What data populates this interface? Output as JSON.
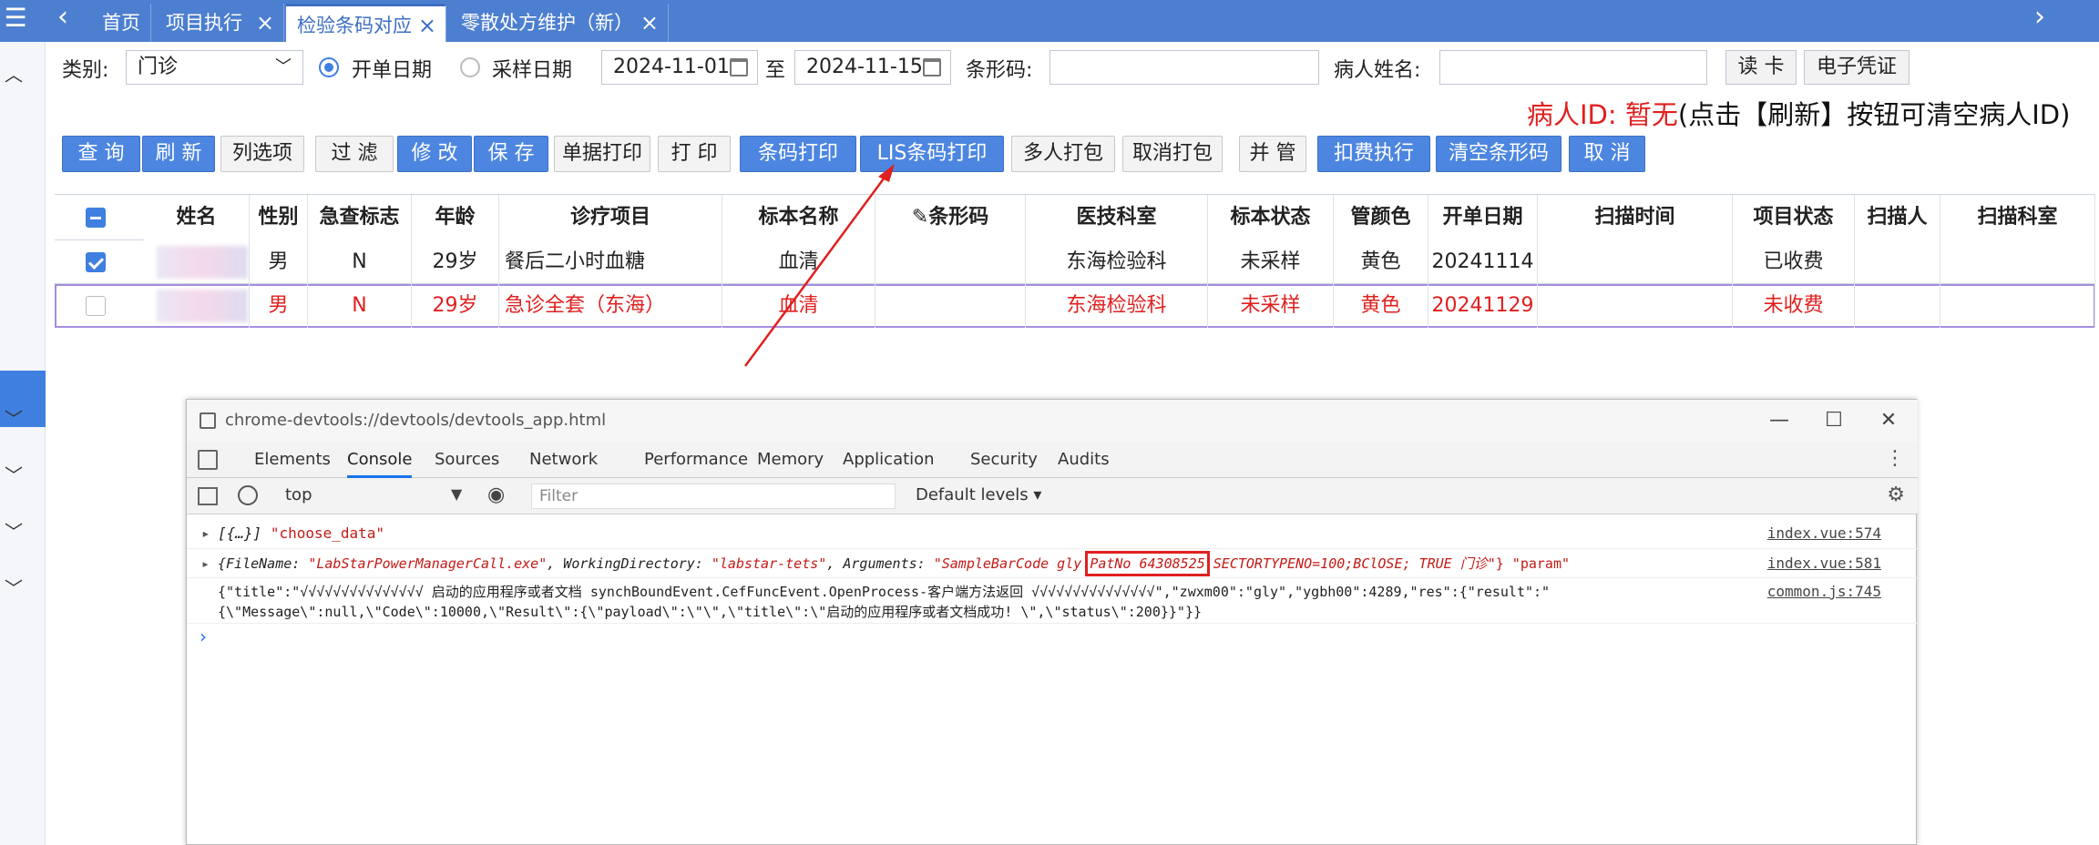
{
  "tabs": [
    {
      "label": "首页",
      "closable": false
    },
    {
      "label": "项目执行",
      "closable": true
    },
    {
      "label": "检验条码对应",
      "closable": true,
      "active": true
    },
    {
      "label": "零散处方维护（新）",
      "closable": true
    }
  ],
  "tab_close_icon": "×",
  "form": {
    "category_label": "类别:",
    "category_value": "门诊",
    "radio_order_date": "开单日期",
    "radio_sample_date": "采样日期",
    "date_from": "2024-11-01",
    "date_sep": "至",
    "date_to": "2024-11-15",
    "barcode_label": "条形码:",
    "patient_name_label": "病人姓名:",
    "read_card": "读 卡",
    "e_voucher": "电子凭证",
    "hint_prefix": "病人ID: 暂无",
    "hint_suffix": "(点击【刷新】按钮可清空病人ID)"
  },
  "toolbar": [
    {
      "label": "查 询",
      "style": "blue"
    },
    {
      "label": "刷 新",
      "style": "blue"
    },
    {
      "label": "列选项",
      "style": "grey"
    },
    {
      "label": "过 滤",
      "style": "grey"
    },
    {
      "label": "修 改",
      "style": "blue"
    },
    {
      "label": "保 存",
      "style": "blue"
    },
    {
      "label": "单据打印",
      "style": "grey"
    },
    {
      "label": "打 印",
      "style": "grey"
    },
    {
      "label": "条码打印",
      "style": "blue"
    },
    {
      "label": "LIS条码打印",
      "style": "blue"
    },
    {
      "label": "多人打包",
      "style": "grey"
    },
    {
      "label": "取消打包",
      "style": "grey"
    },
    {
      "label": "并 管",
      "style": "grey"
    },
    {
      "label": "扣费执行",
      "style": "blue"
    },
    {
      "label": "清空条形码",
      "style": "blue"
    },
    {
      "label": "取 消",
      "style": "blue"
    }
  ],
  "table": {
    "headers": [
      "姓名",
      "性别",
      "急查标志",
      "年龄",
      "诊疗项目",
      "标本名称",
      "条形码",
      "医技科室",
      "标本状态",
      "管颜色",
      "开单日期",
      "扫描时间",
      "项目状态",
      "扫描人",
      "扫描科室"
    ],
    "rows": [
      {
        "checked": true,
        "highlight": false,
        "cells": [
          "",
          "男",
          "N",
          "29岁",
          "餐后二小时血糖",
          "血清",
          "",
          "东海检验科",
          "未采样",
          "黄色",
          "20241114",
          "",
          "已收费",
          "",
          ""
        ]
      },
      {
        "checked": false,
        "highlight": true,
        "cells": [
          "",
          "男",
          "N",
          "29岁",
          "急诊全套（东海）",
          "血清",
          "",
          "东海检验科",
          "未采样",
          "黄色",
          "20241129",
          "",
          "未收费",
          "",
          ""
        ]
      }
    ]
  },
  "devtools": {
    "title": "chrome-devtools://devtools/devtools_app.html",
    "tabs": [
      "Elements",
      "Console",
      "Sources",
      "Network",
      "Performance",
      "Memory",
      "Application",
      "Security",
      "Audits"
    ],
    "active_tab": "Console",
    "context": "top",
    "filter_placeholder": "Filter",
    "levels": "Default levels ▾",
    "logs": [
      {
        "text_a": "[{…}]",
        "text_b": "\"choose_data\"",
        "source": "index.vue:574"
      },
      {
        "pre": "{FileName: ",
        "filename": "\"LabStarPowerManagerCall.exe\"",
        "wd_key": ", WorkingDirectory: ",
        "wd": "\"labstar-tets\"",
        "args_key": ", Arguments: ",
        "args_a": "\"SampleBarCode gly ",
        "patno": "PatNo 64308525",
        "args_b": " SECTORTYPENO=100;BClOSE; TRUE 门诊\"",
        "tail": "} \"param\"",
        "source": "index.vue:581"
      },
      {
        "line1": "{\"title\":\"√√√√√√√√√√√√√√√ 启动的应用程序或者文档 synchBoundEvent.CefFuncEvent.OpenProcess-客户端方法返回 √√√√√√√√√√√√√√√\",\"zwxm00\":\"gly\",\"ygbh00\":4289,\"res\":{\"result\":\"",
        "line2": "{\\\"Message\\\":null,\\\"Code\\\":10000,\\\"Result\\\":{\\\"payload\\\":\\\"\\\",\\\"title\\\":\\\"启动的应用程序或者文档成功! \\\",\\\"status\\\":200}}\"}}",
        "source": "common.js:745"
      }
    ],
    "prompt": "›"
  },
  "colors": {
    "accent": "#4d86e0",
    "annotation_red": "#e02020"
  }
}
